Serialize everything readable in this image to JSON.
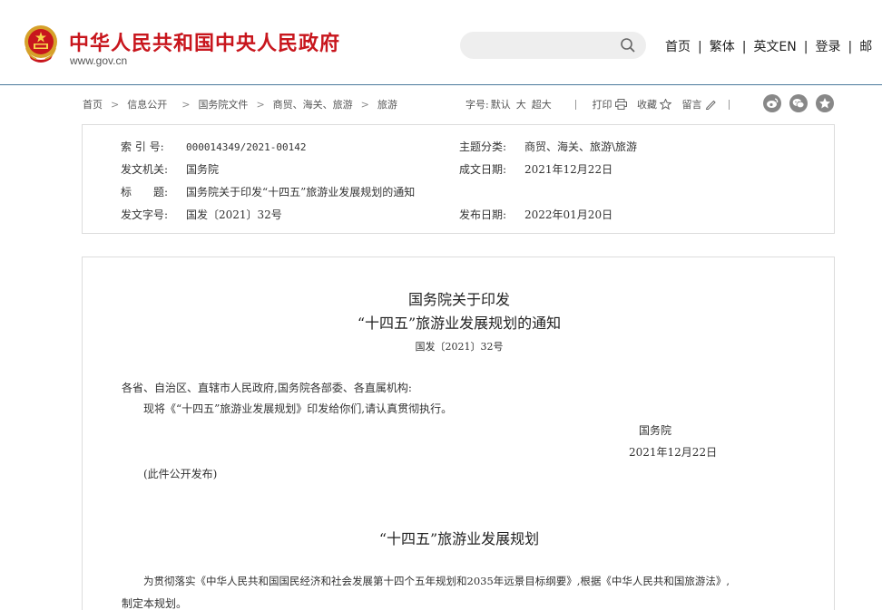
{
  "header": {
    "site_title": "中华人民共和国中央人民政府",
    "site_url": "www.gov.cn",
    "search_placeholder": "",
    "nav": [
      "首页",
      "繁体",
      "英文EN",
      "登录",
      "邮"
    ]
  },
  "toolbar": {
    "breadcrumb": [
      "首页",
      "信息公开",
      "国务院文件",
      "商贸、海关、旅游",
      "旅游"
    ],
    "font_label": "字号:",
    "font_sizes": [
      "默认",
      "大",
      "超大"
    ],
    "print": "打印",
    "favorite": "收藏",
    "comment": "留言",
    "share_icons": [
      "weibo-icon",
      "wechat-icon",
      "qzone-icon"
    ]
  },
  "meta": {
    "index_label": "索 引 号:",
    "index_value": "000014349/2021-00142",
    "category_label": "主题分类:",
    "category_value": "商贸、海关、旅游\\旅游",
    "issuer_label": "发文机关:",
    "issuer_value": "国务院",
    "written_label": "成文日期:",
    "written_value": "2021年12月22日",
    "title_label": "标　　题:",
    "title_value": "国务院关于印发“十四五”旅游业发展规划的通知",
    "docno_label": "发文字号:",
    "docno_value": "国发〔2021〕32号",
    "publish_label": "发布日期:",
    "publish_value": "2022年01月20日"
  },
  "article": {
    "title_line1": "国务院关于印发",
    "title_line2": "“十四五”旅游业发展规划的通知",
    "doc_no": "国发〔2021〕32号",
    "salutation": "各省、自治区、直辖市人民政府,国务院各部委、各直属机构:",
    "body1": "现将《“十四五”旅游业发展规划》印发给你们,请认真贯彻执行。",
    "signer": "国务院",
    "sign_date": "2021年12月22日",
    "public_note": "(此件公开发布)",
    "plan_title": "“十四五”旅游业发展规划",
    "plan_para_line1": "为贯彻落实《中华人民共和国国民经济和社会发展第十四个五年规划和2035年远景目标纲要》,根据《中华人民共和国旅游法》,",
    "plan_para_line2": "制定本规划。"
  },
  "colors": {
    "brand_red": "#c8161d",
    "header_rule": "#4b7a9c",
    "panel_border": "#dcdcdc"
  }
}
